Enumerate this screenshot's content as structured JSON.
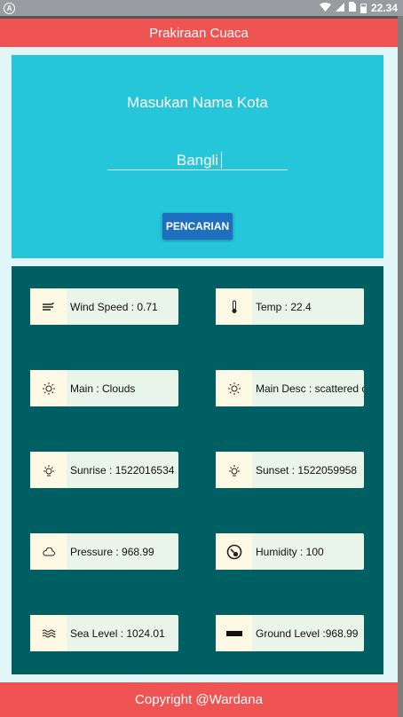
{
  "status_bar": {
    "time": "22.34",
    "battery_level": 0.7,
    "icons": [
      "android-logo-icon",
      "wifi-icon",
      "signal-icon",
      "no-sim-icon",
      "battery-icon"
    ]
  },
  "app_bar": {
    "title": "Prakiraan Cuaca"
  },
  "colors": {
    "app_bar": "#ef5452",
    "search_card": "#25c6da",
    "info_panel": "#005f62",
    "button": "#1e6fc0",
    "tile": "#e8f5e8",
    "tile_icon_bg": "#fdf9e4",
    "content_bg": "#e0f6f8"
  },
  "search": {
    "title": "Masukan Nama Kota",
    "city_value": "Bangli",
    "button_label": "PENCARIAN"
  },
  "weather": [
    {
      "icon": "wind-icon",
      "glyph": "≈",
      "label": "Wind Speed : 0.71"
    },
    {
      "icon": "thermometer-icon",
      "glyph": "🌡",
      "label": "Temp : 22.4"
    },
    {
      "icon": "sun-icon",
      "glyph": "☼",
      "label": "Main : Clouds"
    },
    {
      "icon": "sun-icon",
      "glyph": "☼",
      "label": "Main Desc : scattered c"
    },
    {
      "icon": "sunrise-icon",
      "glyph": "☼",
      "label": "Sunrise : 1522016534"
    },
    {
      "icon": "sunset-icon",
      "glyph": "☼",
      "label": "Sunset : 1522059958"
    },
    {
      "icon": "cloud-icon",
      "glyph": "☁",
      "label": "Pressure : 968.99"
    },
    {
      "icon": "gauge-icon",
      "glyph": "◔",
      "label": "Humidity : 100"
    },
    {
      "icon": "waves-icon",
      "glyph": "≈",
      "label": "Sea Level : 1024.01"
    },
    {
      "icon": "ground-icon",
      "glyph": "▬",
      "label": "Ground Level :968.99"
    }
  ],
  "footer": {
    "text": "Copyright @Wardana"
  }
}
